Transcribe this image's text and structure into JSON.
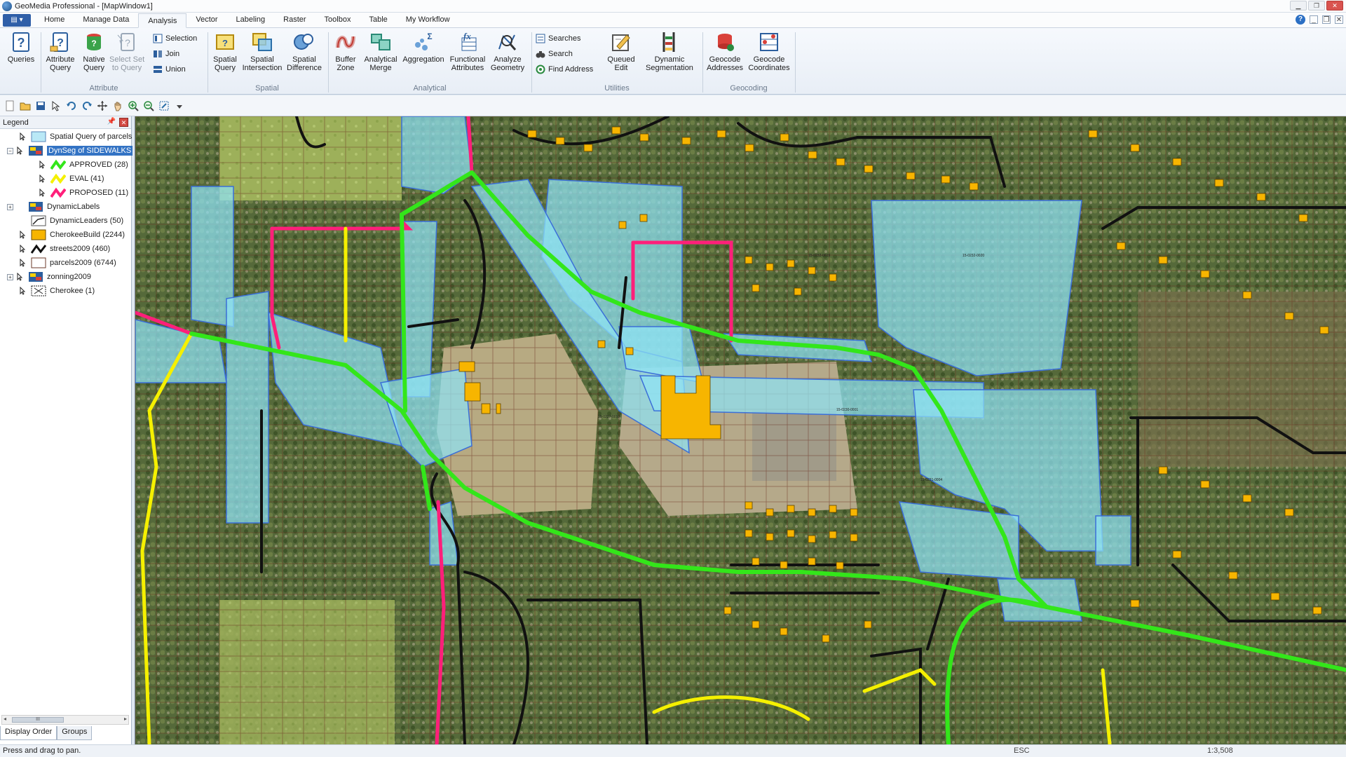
{
  "window": {
    "title": "GeoMedia Professional - [MapWindow1]"
  },
  "ribbon_tabs": [
    "Home",
    "Manage Data",
    "Analysis",
    "Vector",
    "Labeling",
    "Raster",
    "Toolbox",
    "Table",
    "My Workflow"
  ],
  "active_tab": "Analysis",
  "ribbon": {
    "queries": "Queries",
    "attribute_query": "Attribute\nQuery",
    "native_query": "Native\nQuery",
    "select_set_to_query": "Select Set\nto Query",
    "selection": "Selection",
    "join": "Join",
    "union": "Union",
    "spatial_query": "Spatial\nQuery",
    "spatial_intersection": "Spatial\nIntersection",
    "spatial_difference": "Spatial\nDifference",
    "buffer_zone": "Buffer\nZone",
    "analytical_merge": "Analytical\nMerge",
    "aggregation": "Aggregation",
    "functional_attributes": "Functional\nAttributes",
    "analyze_geometry": "Analyze\nGeometry",
    "searches": "Searches",
    "search": "Search",
    "find_address": "Find Address",
    "queued_edit": "Queued\nEdit",
    "dynamic_segmentation": "Dynamic\nSegmentation",
    "geocode_addresses": "Geocode\nAddresses",
    "geocode_coordinates": "Geocode\nCoordinates",
    "groups": {
      "attribute": "Attribute",
      "spatial": "Spatial",
      "analytical": "Analytical",
      "utilities": "Utilities",
      "geocoding": "Geocoding"
    }
  },
  "legend": {
    "title": "Legend",
    "items": [
      {
        "label": "Spatial Query of parcels"
      },
      {
        "label": "DynSeg of SIDEWALKS"
      },
      {
        "label": "APPROVED (28)"
      },
      {
        "label": "EVAL (41)"
      },
      {
        "label": "PROPOSED (11)"
      },
      {
        "label": "DynamicLabels"
      },
      {
        "label": "DynamicLeaders (50)"
      },
      {
        "label": "CherokeeBuild (2244)"
      },
      {
        "label": "streets2009 (460)"
      },
      {
        "label": "parcels2009 (6744)"
      },
      {
        "label": "zonning2009"
      },
      {
        "label": "Cherokee (1)"
      }
    ],
    "scroll_thumb": "III",
    "tabs": [
      "Display Order",
      "Groups"
    ]
  },
  "colors": {
    "approved": "#33e61a",
    "eval": "#f5f000",
    "proposed": "#ff1f7a",
    "query_fill": "#8fe3f5",
    "building": "#f7b500",
    "selection": "#3373c4"
  },
  "status": {
    "message": "Press and drag to pan.",
    "esc": "ESC",
    "scale": "1:3,508"
  }
}
